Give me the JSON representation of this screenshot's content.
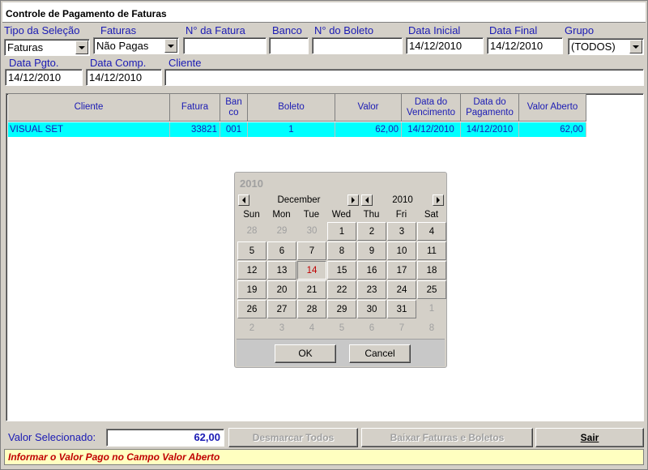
{
  "window": {
    "title": "Controle de Pagamento de Faturas"
  },
  "filters": {
    "tipo_selecao": {
      "label": "Tipo da Seleção",
      "value": "Faturas"
    },
    "faturas": {
      "label": "Faturas",
      "value": "Não Pagas"
    },
    "numero_fatura": {
      "label": "N° da Fatura",
      "value": ""
    },
    "banco": {
      "label": "Banco",
      "value": ""
    },
    "numero_boleto": {
      "label": "N° do Boleto",
      "value": ""
    },
    "data_inicial": {
      "label": "Data Inicial",
      "value": "14/12/2010"
    },
    "data_final": {
      "label": "Data Final",
      "value": "14/12/2010"
    },
    "grupo": {
      "label": "Grupo",
      "value": "(TODOS)"
    },
    "data_pgto": {
      "label": "Data Pgto.",
      "value": "14/12/2010"
    },
    "data_comp": {
      "label": "Data Comp.",
      "value": "14/12/2010"
    },
    "cliente": {
      "label": "Cliente",
      "value": ""
    }
  },
  "table": {
    "columns": [
      {
        "l1": "Cliente",
        "l2": ""
      },
      {
        "l1": "Fatura",
        "l2": ""
      },
      {
        "l1": "Ban",
        "l2": "co"
      },
      {
        "l1": "Boleto",
        "l2": ""
      },
      {
        "l1": "Valor",
        "l2": ""
      },
      {
        "l1": "Data do",
        "l2": "Vencimento"
      },
      {
        "l1": "Data do",
        "l2": "Pagamento"
      },
      {
        "l1": "Valor Aberto",
        "l2": ""
      }
    ],
    "rows": [
      {
        "cliente": "VISUAL SET",
        "fatura": "33821",
        "banco": "001",
        "boleto": "1",
        "valor": "62,00",
        "vencimento": "14/12/2010",
        "pagamento": "14/12/2010",
        "valor_aberto": "62,00"
      }
    ]
  },
  "calendar": {
    "year_title": "2010",
    "month": "December",
    "year": "2010",
    "weekdays": [
      "Sun",
      "Mon",
      "Tue",
      "Wed",
      "Thu",
      "Fri",
      "Sat"
    ],
    "weeks": [
      [
        "28",
        "29",
        "30",
        "1",
        "2",
        "3",
        "4"
      ],
      [
        "5",
        "6",
        "7",
        "8",
        "9",
        "10",
        "11"
      ],
      [
        "12",
        "13",
        "14",
        "15",
        "16",
        "17",
        "18"
      ],
      [
        "19",
        "20",
        "21",
        "22",
        "23",
        "24",
        "25"
      ],
      [
        "26",
        "27",
        "28",
        "29",
        "30",
        "31",
        "1"
      ],
      [
        "2",
        "3",
        "4",
        "5",
        "6",
        "7",
        "8"
      ]
    ],
    "today": "14",
    "ok_label": "OK",
    "cancel_label": "Cancel"
  },
  "footer": {
    "valor_label": "Valor Selecionado:",
    "valor_value": "62,00",
    "desmarcar_label": "Desmarcar Todos",
    "baixar_label": "Baixar Faturas e Boletos",
    "sair_label": "Sair",
    "status": "Informar o Valor Pago no Campo Valor Aberto"
  },
  "colors": {
    "label_blue": "#1a1ab4",
    "selection_cyan": "#00ffff",
    "status_red": "#c00000",
    "status_bg": "#ffffc0"
  }
}
